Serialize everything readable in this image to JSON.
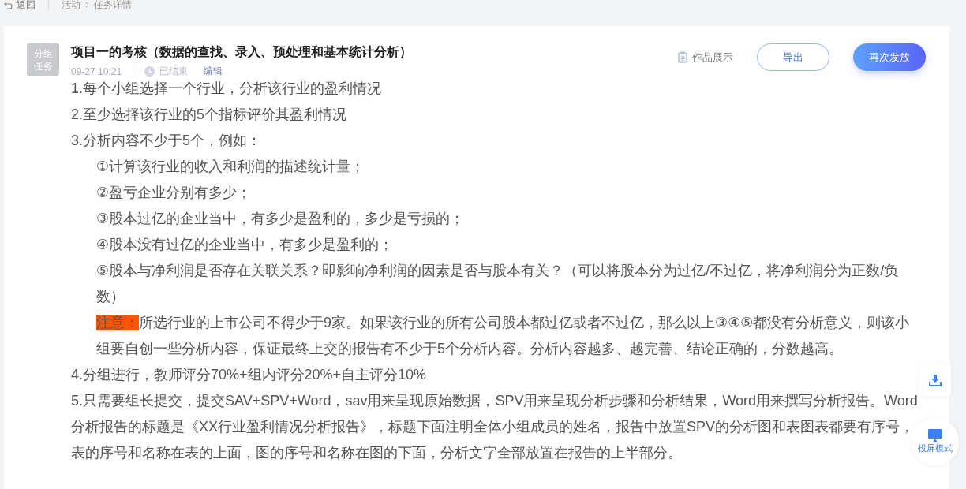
{
  "breadcrumb": {
    "back": "返回",
    "items": [
      "活动",
      "任务详情"
    ]
  },
  "task": {
    "badge": "分组任务",
    "title": "项目一的考核（数据的查找、录入、预处理和基本统计分析）",
    "time": "09-27 10:21",
    "status": "已结束",
    "edit": "编辑"
  },
  "actions": {
    "showcase": "作品展示",
    "export": "导出",
    "reissue": "再次发放"
  },
  "content": [
    {
      "kind": "line",
      "text": "1.每个小组选择一个行业，分析该行业的盈利情况"
    },
    {
      "kind": "line",
      "text": "2.至少选择该行业的5个指标评价其盈利情况"
    },
    {
      "kind": "line",
      "text": "3.分析内容不少于5个，例如："
    },
    {
      "kind": "indent",
      "text": "①计算该行业的收入和利润的描述统计量；"
    },
    {
      "kind": "indent",
      "text": "②盈亏企业分别有多少；"
    },
    {
      "kind": "indent",
      "text": "③股本过亿的企业当中，有多少是盈利的，多少是亏损的；"
    },
    {
      "kind": "indent",
      "text": "④股本没有过亿的企业当中，有多少是盈利的；"
    },
    {
      "kind": "indent",
      "text": "⑤股本与净利润是否存在关联关系？即影响净利润的因素是否与股本有关？（可以将股本分为过亿/不过亿，将净利润分为正数/负数）"
    },
    {
      "kind": "note",
      "label": "注意：",
      "text": "所选行业的上市公司不得少于9家。如果该行业的所有公司股本都过亿或者不过亿，那么以上③④⑤都没有分析意义，则该小组要自创一些分析内容，保证最终上交的报告有不少于5个分析内容。分析内容越多、越完善、结论正确的，分数越高。"
    },
    {
      "kind": "line",
      "text": "4.分组进行，教师评分70%+组内评分20%+自主评分10%"
    },
    {
      "kind": "line",
      "text": "5.只需要组长提交，提交SAV+SPV+Word，sav用来呈现原始数据，SPV用来呈现分析步骤和分析结果，Word用来撰写分析报告。Word分析报告的标题是《XX行业盈利情况分析报告》，标题下面注明全体小组成员的姓名，报告中放置SPV的分析图和表图表都要有序号，表的序号和名称在表的上面，图的序号和名称在图的下面，分析文字全部放置在报告的上半部分。"
    }
  ],
  "float": {
    "screen_mode": "投屏模式"
  }
}
